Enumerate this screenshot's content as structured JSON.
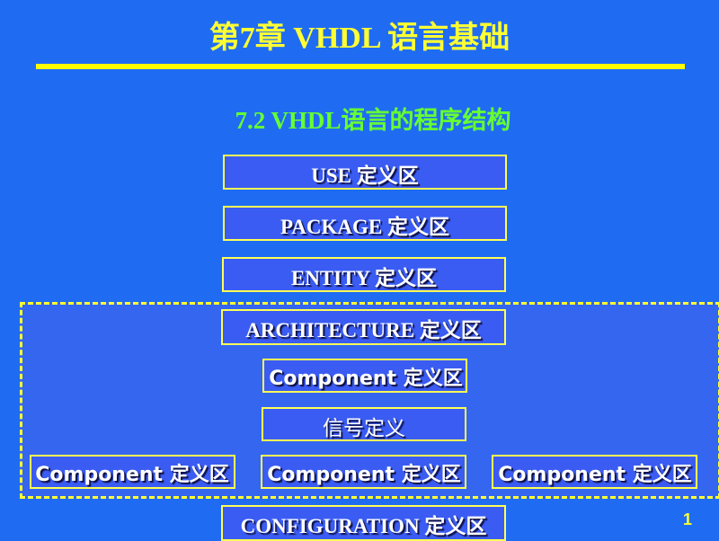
{
  "slide": {
    "title": "第7章  VHDL 语言基础",
    "subtitle": "7.2  VHDL语言的程序结构",
    "page_number": "1",
    "colors": {
      "background": "#1f6cf2",
      "title": "#ffff33",
      "subtitle": "#66ff33",
      "box_border": "#ffff55",
      "dashed_border": "#ffff33"
    }
  },
  "blocks": {
    "use": "USE  定义区",
    "package": "PACKAGE  定义区",
    "entity": "ENTITY  定义区",
    "architecture": "ARCHITECTURE 定义区",
    "component_top": "Component 定义区",
    "signal": "信号定义",
    "component_left": "Component 定义区",
    "component_mid": "Component 定义区",
    "component_right": "Component 定义区",
    "configuration": "CONFIGURATION 定义区"
  }
}
